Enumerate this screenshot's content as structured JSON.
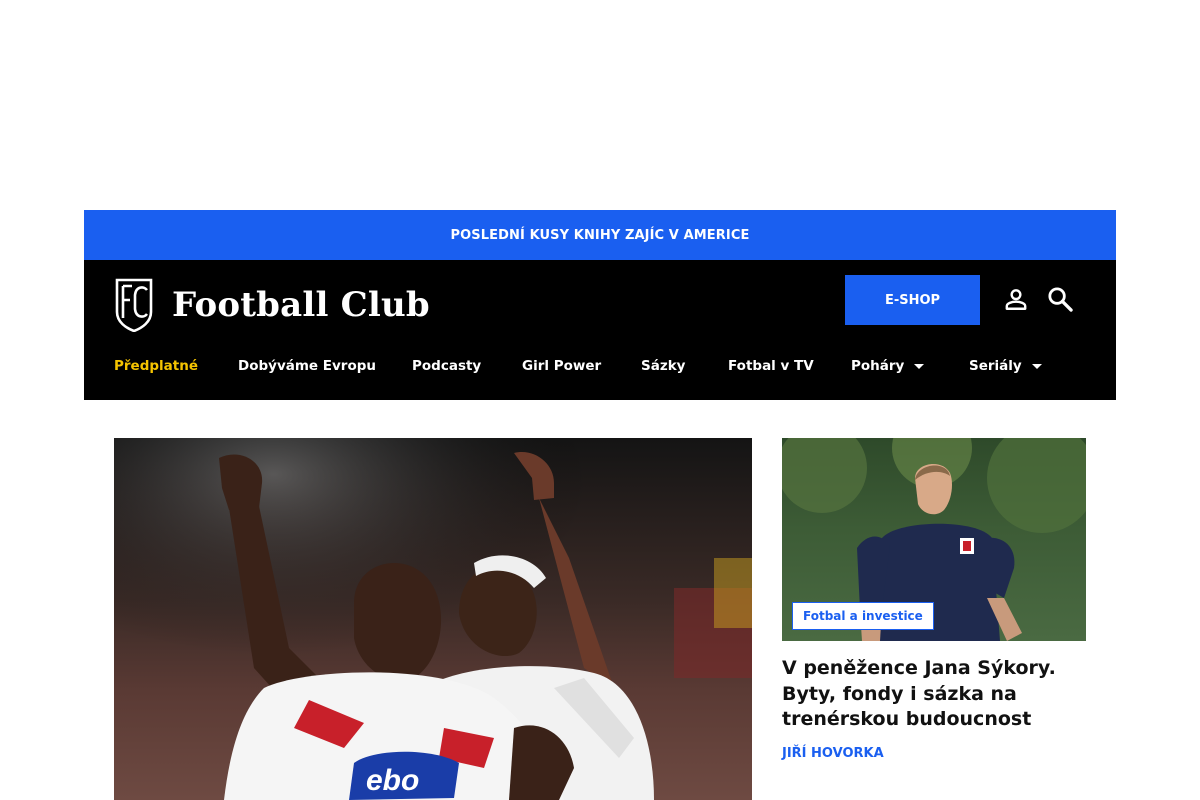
{
  "promo": {
    "text": "POSLEDNÍ KUSY KNIHY ZAJÍC V AMERICE"
  },
  "header": {
    "logo_text": "Football Club",
    "eshop_label": "E-SHOP",
    "icons": [
      "user-icon",
      "search-icon"
    ]
  },
  "nav": {
    "items": [
      {
        "label": "Předplatné",
        "active": true
      },
      {
        "label": "Dobýváme Evropu"
      },
      {
        "label": "Podcasty"
      },
      {
        "label": "Girl Power"
      },
      {
        "label": "Sázky"
      },
      {
        "label": "Fotbal v TV"
      },
      {
        "label": "Poháry",
        "dropdown": true
      },
      {
        "label": "Seriály",
        "dropdown": true
      }
    ]
  },
  "articles": {
    "side": {
      "category": "Fotbal a investice",
      "title": "V peněžence Jana Sýkory. Byty, fondy i sázka na trenérskou budoucnost",
      "author": "JIŘÍ HOVORKA"
    }
  },
  "colors": {
    "accent": "#1a5ff0",
    "header_bg": "#000000",
    "active_nav": "#f5c400"
  }
}
